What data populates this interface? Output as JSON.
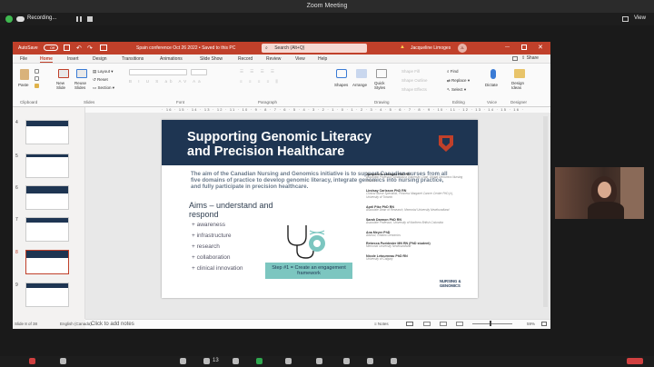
{
  "zoom": {
    "window_title": "Zoom Meeting",
    "recording_label": "Recording...",
    "view_label": "View",
    "participants_count": "13"
  },
  "ppt": {
    "autosave": "AutoSave",
    "autosave_state": "Off",
    "doc_title": "Spain conference Oct 26 2022 • Saved to this PC",
    "search_placeholder": "Search (Alt+Q)",
    "user": "Jacqueline Limoges",
    "user_initials": "JL",
    "tabs": [
      "File",
      "Home",
      "Insert",
      "Design",
      "Transitions",
      "Animations",
      "Slide Show",
      "Record",
      "Review",
      "View",
      "Help"
    ],
    "share_label": "Share",
    "ribbon": {
      "paste": "Paste",
      "new_slide": "New Slide",
      "reuse_slides": "Reuse Slides",
      "layout": "Layout",
      "reset": "Reset",
      "section": "Section",
      "shapes": "Shapes",
      "arrange": "Arrange",
      "quick_styles": "Quick Styles",
      "shape_fill": "Shape Fill",
      "shape_outline": "Shape Outline",
      "shape_effects": "Shape Effects",
      "find": "Find",
      "replace": "Replace",
      "select": "Select",
      "dictate": "Dictate",
      "design_ideas": "Design Ideas",
      "groups": [
        "Clipboard",
        "Slides",
        "Font",
        "Paragraph",
        "Drawing",
        "Editing",
        "Voice",
        "Designer"
      ]
    },
    "thumb_numbers": [
      "4",
      "5",
      "6",
      "7",
      "8",
      "9"
    ],
    "ruler": "· 16 · 15 · 14 · 13 · 12 · 11 · 10 · 9 · 8 · 7 · 6 · 5 · 4 · 3 · 2 · 1 · 0 · 1 · 2 · 3 · 4 · 5 · 6 · 7 · 8 · 9 · 10 · 11 · 12 · 13 · 14 · 15 · 16 ·",
    "notes_placeholder": "Click to add notes",
    "status": {
      "slide": "Slide 8 of 38",
      "language": "English (Canada)",
      "notes": "Notes",
      "zoom": "59%"
    }
  },
  "slide": {
    "title_line1": "Supporting Genomic Literacy",
    "title_line2": "and Precision Healthcare",
    "intro": "The aim of the Canadian Nursing and Genomics initiative is to support Canadian nurses from all five domains of practice to develop genomic literacy, integrate genomics into nursing practice, and fully participate in precision healthcare.",
    "aims_heading_1": "Aims – understand and",
    "aims_heading_2": "respond",
    "aims": [
      "+ awareness",
      "+ infrastructure",
      "+ research",
      "+ collaboration",
      "+ clinical innovation"
    ],
    "step": "Step #1 = Create an engagement framework",
    "people": [
      {
        "name": "Jacqueline Limoges PhD RN",
        "role": "Associate Professor, Athabasca University Chair, Global Genomics Nursing Alliance"
      },
      {
        "name": "Lindsay Carlsson PhD RN",
        "role": "Clinical Nurse Specialist, Princess Margaret Cancer Centre PhD (c), University of Toronto"
      },
      {
        "name": "April Pike PhD RN",
        "role": "Associate Dean of Research, Memorial University Newfoundland"
      },
      {
        "name": "Sarah Darmon PhD RN",
        "role": "Associate Professor, University of Northern British Columbia"
      },
      {
        "name": "Ana Meyer PhD",
        "role": "Advisor, Ontario Genomics"
      },
      {
        "name": "Rebecca Puddester MN RN (PhD student)",
        "role": "Memorial University Newfoundland"
      },
      {
        "name": "Nicole Letourneau PhD RN",
        "role": "University of Calgary"
      }
    ],
    "logo_line1": "NURSING &",
    "logo_line2": "GENOMICS"
  },
  "colors": {
    "ppt_accent": "#c0402a",
    "slide_header": "#1e3552",
    "step_box": "#7cc6c0"
  }
}
